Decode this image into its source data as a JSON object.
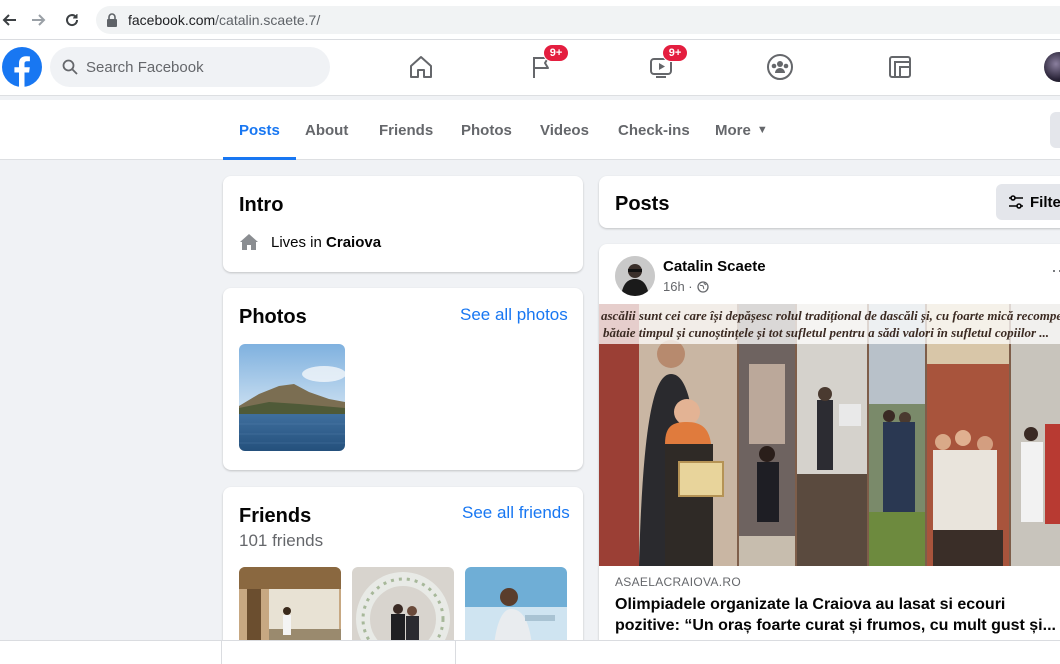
{
  "browser": {
    "url_domain": "facebook.com",
    "url_path": "/catalin.scaete.7/"
  },
  "header": {
    "search_placeholder": "Search Facebook",
    "pages_badge": "9+",
    "watch_badge": "9+"
  },
  "tabs": [
    {
      "label": "Posts",
      "active": true
    },
    {
      "label": "About"
    },
    {
      "label": "Friends"
    },
    {
      "label": "Photos"
    },
    {
      "label": "Videos"
    },
    {
      "label": "Check-ins"
    },
    {
      "label": "More"
    }
  ],
  "intro": {
    "title": "Intro",
    "lives_prefix": "Lives in",
    "lives_city": "Craiova"
  },
  "photos": {
    "title": "Photos",
    "see_all": "See all photos"
  },
  "friends": {
    "title": "Friends",
    "count": "101 friends",
    "see_all": "See all friends"
  },
  "posts": {
    "title": "Posts",
    "filters_label": "Filte"
  },
  "post": {
    "author": "Catalin Scaete",
    "time": "16h ·",
    "image_caption_line1": "ascălii sunt cei care își depășesc rolul tradițional de dascăli și, cu foarte mică recompensa",
    "image_caption_line2": "bătaie timpul și cunoștințele și tot sufletul pentru a sădi valori în sufletul copiilor ...",
    "link_source": "ASAELACRAIOVA.RO",
    "link_title": "Olimpiadele organizate la Craiova au lasat si ecouri pozitive: “Un oraș foarte curat și frumos, cu mult gust și..."
  },
  "colors": {
    "accent": "#1877f2",
    "badge": "#e41e3f",
    "background": "#f0f2f5"
  }
}
